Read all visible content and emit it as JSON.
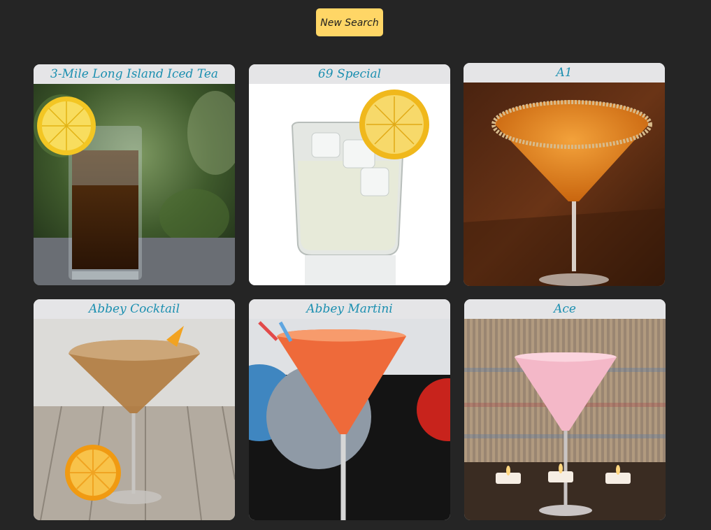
{
  "header": {
    "new_search_label": "New Search"
  },
  "drinks": [
    {
      "name": "3-Mile Long Island Iced Tea",
      "image": "highball-iced-tea-with-lemon"
    },
    {
      "name": "69 Special",
      "image": "rocks-glass-with-lemon"
    },
    {
      "name": "A1",
      "image": "orange-martini-with-sugar-rim"
    },
    {
      "name": "Abbey Cocktail",
      "image": "amber-martini-with-orange"
    },
    {
      "name": "Abbey Martini",
      "image": "red-martini-with-straws"
    },
    {
      "name": "Ace",
      "image": "pink-martini-with-candles"
    }
  ],
  "colors": {
    "background": "#252525",
    "button": "#ffd666",
    "title_text": "#1b8fb0",
    "title_bar": "#e5e5e7"
  }
}
